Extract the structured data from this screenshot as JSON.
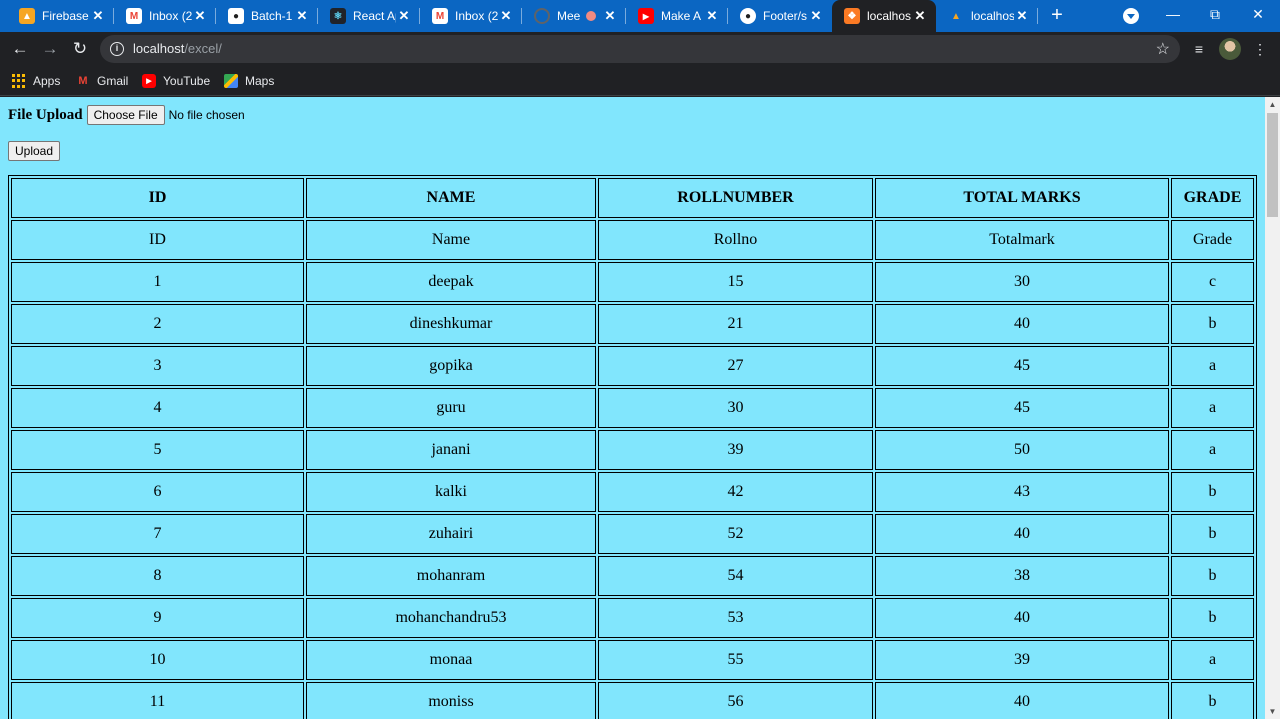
{
  "browser": {
    "tabs": [
      {
        "title": "Firebase",
        "icon": "firebase-icon",
        "color": "#f6a623"
      },
      {
        "title": "Inbox (2",
        "icon": "gmail-icon",
        "color": "#ea4335"
      },
      {
        "title": "Batch-1",
        "icon": "account-icon",
        "color": "#1f1f1f"
      },
      {
        "title": "React Ap",
        "icon": "react-icon",
        "color": "#20232a"
      },
      {
        "title": "Inbox (2",
        "icon": "gmail-icon",
        "color": "#ea4335"
      },
      {
        "title": "Mee",
        "icon": "meet-icon",
        "color": "#5f6368"
      },
      {
        "title": "Make A",
        "icon": "youtube-icon",
        "color": "#ff0000"
      },
      {
        "title": "Footer/s",
        "icon": "github-icon",
        "color": "#1f1f1f"
      },
      {
        "title": "localhos",
        "icon": "xampp-icon",
        "color": "#fb7a24"
      },
      {
        "title": "localhos",
        "icon": "phpmyadmin-icon",
        "color": "#6c78af"
      }
    ],
    "active_tab_index": 8,
    "url_host": "localhost",
    "url_path": "/excel/",
    "bookmarks": [
      {
        "label": "Apps",
        "icon": "apps-grid-icon"
      },
      {
        "label": "Gmail",
        "icon": "gmail-icon"
      },
      {
        "label": "YouTube",
        "icon": "youtube-icon"
      },
      {
        "label": "Maps",
        "icon": "maps-icon"
      }
    ]
  },
  "upload": {
    "label": "File Upload",
    "choose_button": "Choose File",
    "file_status": "No file chosen",
    "upload_button": "Upload"
  },
  "table": {
    "headers": [
      "ID",
      "NAME",
      "ROLLNUMBER",
      "TOTAL MARKS",
      "GRADE"
    ],
    "rows": [
      [
        "ID",
        "Name",
        "Rollno",
        "Totalmark",
        "Grade"
      ],
      [
        "1",
        "deepak",
        "15",
        "30",
        "c"
      ],
      [
        "2",
        "dineshkumar",
        "21",
        "40",
        "b"
      ],
      [
        "3",
        "gopika",
        "27",
        "45",
        "a"
      ],
      [
        "4",
        "guru",
        "30",
        "45",
        "a"
      ],
      [
        "5",
        "janani",
        "39",
        "50",
        "a"
      ],
      [
        "6",
        "kalki",
        "42",
        "43",
        "b"
      ],
      [
        "7",
        "zuhairi",
        "52",
        "40",
        "b"
      ],
      [
        "8",
        "mohanram",
        "54",
        "38",
        "b"
      ],
      [
        "9",
        "mohanchandru53",
        "53",
        "40",
        "b"
      ],
      [
        "10",
        "monaa",
        "55",
        "39",
        "a"
      ],
      [
        "11",
        "moniss",
        "56",
        "40",
        "b"
      ]
    ]
  },
  "colors": {
    "page_background": "#81e6fd",
    "tab_strip": "#0b66c2",
    "browser_chrome": "#202124"
  }
}
